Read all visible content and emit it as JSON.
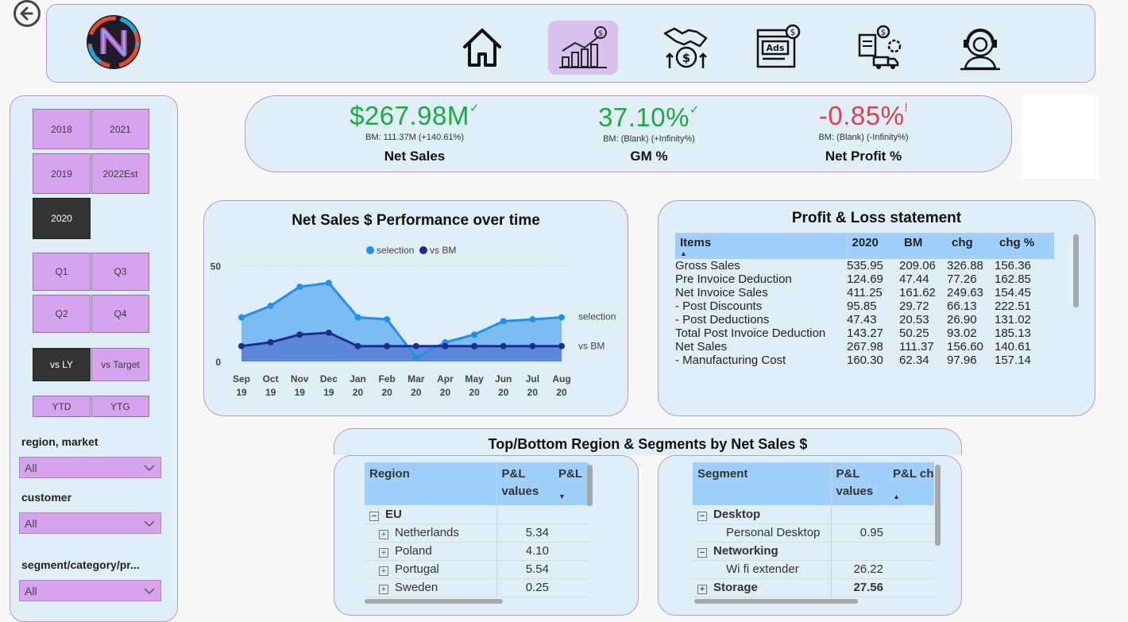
{
  "nav": {
    "items": [
      {
        "name": "home",
        "icon": "home-icon"
      },
      {
        "name": "sales",
        "icon": "bar-chart-icon",
        "active": true
      },
      {
        "name": "finance",
        "icon": "handshake-icon"
      },
      {
        "name": "marketing",
        "icon": "ads-icon"
      },
      {
        "name": "supply-chain",
        "icon": "logistics-icon"
      },
      {
        "name": "support",
        "icon": "support-agent-icon"
      }
    ]
  },
  "slicers": {
    "years": [
      {
        "label": "2018",
        "selected": false
      },
      {
        "label": "2021",
        "selected": false
      },
      {
        "label": "2019",
        "selected": false
      },
      {
        "label": "2022Est",
        "selected": false
      },
      {
        "label": "2020",
        "selected": true
      }
    ],
    "quarters": [
      "Q1",
      "Q3",
      "Q2",
      "Q4"
    ],
    "compare": {
      "vs_ly": "vs LY",
      "vs_target": "vs Target"
    },
    "ytd": "YTD",
    "ytg": "YTG",
    "region_label": "region, market",
    "region_value": "All",
    "customer_label": "customer",
    "customer_value": "All",
    "segment_label": "segment/category/pr...",
    "segment_value": "All"
  },
  "kpis": {
    "net_sales": {
      "value": "$267.98M",
      "mark": "✓",
      "bm": "BM: 111.37M (+140.61%)",
      "title": "Net Sales"
    },
    "gm": {
      "value": "37.10%",
      "mark": "✓",
      "bm": "BM: (Blank) (+Infinity%)",
      "title": "GM %"
    },
    "net_profit": {
      "value": "-0.85%",
      "mark": "!",
      "bm": "BM: (Blank) (-Infinity%)",
      "title": "Net Profit %"
    }
  },
  "colors": {
    "good": "#1aab40",
    "bad": "#d64550",
    "selection": "#1e90f0",
    "bm": "#1d2b94",
    "purple": "#d8a3ee"
  },
  "chart": {
    "title": "Net Sales $ Performance over time",
    "legend": {
      "selection": "selection",
      "bm": "vs BM"
    },
    "end_labels": {
      "selection": "selection",
      "bm": "vs BM"
    }
  },
  "chart_data": {
    "type": "area",
    "categories": [
      "Sep 19",
      "Oct 19",
      "Nov 19",
      "Dec 19",
      "Jan 20",
      "Feb 20",
      "Mar 20",
      "Apr 20",
      "May 20",
      "Jun 20",
      "Jul 20",
      "Aug 20"
    ],
    "x_ticks": [
      [
        "Sep",
        "19"
      ],
      [
        "Oct",
        "19"
      ],
      [
        "Nov",
        "19"
      ],
      [
        "Dec",
        "19"
      ],
      [
        "Jan",
        "20"
      ],
      [
        "Feb",
        "20"
      ],
      [
        "Mar",
        "20"
      ],
      [
        "Apr",
        "20"
      ],
      [
        "May",
        "20"
      ],
      [
        "Jun",
        "20"
      ],
      [
        "Jul",
        "20"
      ],
      [
        "Aug",
        "20"
      ]
    ],
    "series": [
      {
        "name": "selection",
        "values": [
          23,
          29,
          39,
          41,
          23,
          22,
          2,
          10,
          14,
          21,
          22,
          23
        ]
      },
      {
        "name": "vs BM",
        "values": [
          8,
          10,
          14,
          15,
          8,
          8,
          8,
          8,
          8,
          8,
          8,
          8
        ]
      }
    ],
    "y_ticks": [
      0,
      50
    ],
    "ylim": [
      0,
      56
    ],
    "grid": true,
    "legend_position": "top-center"
  },
  "pl": {
    "title": "Profit & Loss statement",
    "headers": [
      "Items",
      "2020",
      "BM",
      "chg",
      "chg %"
    ],
    "rows": [
      [
        "Gross Sales",
        "535.95",
        "209.06",
        "326.88",
        "156.36"
      ],
      [
        "Pre Invoice Deduction",
        "124.69",
        "47.44",
        "77.26",
        "162.85"
      ],
      [
        "Net Invoice Sales",
        "411.25",
        "161.62",
        "249.63",
        "154.45"
      ],
      [
        "- Post Discounts",
        "95.85",
        "29.72",
        "66.13",
        "222.51"
      ],
      [
        "- Post Deductions",
        "47.43",
        "20.53",
        "26.90",
        "131.02"
      ],
      [
        "Total Post Invoice Deduction",
        "143.27",
        "50.25",
        "93.02",
        "185.13"
      ],
      [
        "Net Sales",
        "267.98",
        "111.37",
        "156.60",
        "140.61"
      ],
      [
        "- Manufacturing Cost",
        "160.30",
        "62.34",
        "97.96",
        "157.14"
      ]
    ]
  },
  "topbottom": {
    "title": "Top/Bottom Region & Segments by Net Sales $",
    "region": {
      "headers": [
        "Region",
        "P&L values",
        "P&L"
      ],
      "group": "EU",
      "rows": [
        {
          "label": "Netherlands",
          "value": "5.34"
        },
        {
          "label": "Poland",
          "value": "4.10"
        },
        {
          "label": "Portugal",
          "value": "5.54"
        },
        {
          "label": "Sweden",
          "value": "0.25"
        }
      ]
    },
    "segment": {
      "headers": [
        "Segment",
        "P&L values",
        "P&L ch"
      ],
      "rows": [
        {
          "label": "Desktop",
          "value": "",
          "level": 0,
          "expanded": true
        },
        {
          "label": "Personal Desktop",
          "value": "0.95",
          "level": 1
        },
        {
          "label": "Networking",
          "value": "",
          "level": 0,
          "expanded": true
        },
        {
          "label": "Wi fi extender",
          "value": "26.22",
          "level": 1
        },
        {
          "label": "Storage",
          "value": "27.56",
          "level": 0,
          "expanded": false
        }
      ]
    }
  }
}
